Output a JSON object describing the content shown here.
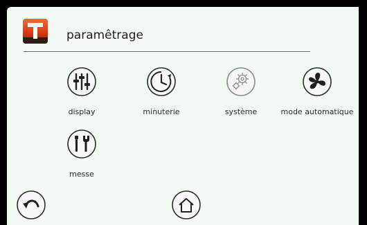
{
  "header": {
    "title": "paramêtrage",
    "logo_letter": "T"
  },
  "tiles": [
    {
      "label": "display",
      "icon": "sliders-icon"
    },
    {
      "label": "minuterie",
      "icon": "timer-clock-icon"
    },
    {
      "label": "système",
      "icon": "gears-icon"
    },
    {
      "label": "mode automatique",
      "icon": "fan-icon"
    },
    {
      "label": "messe",
      "icon": "tools-icon"
    }
  ],
  "nav": {
    "back_icon": "back-arrow-icon",
    "home_icon": "home-icon"
  },
  "colors": {
    "background": "#f3faf4",
    "logo_red": "#e2401c",
    "icon_stroke": "#2b2b2b"
  }
}
